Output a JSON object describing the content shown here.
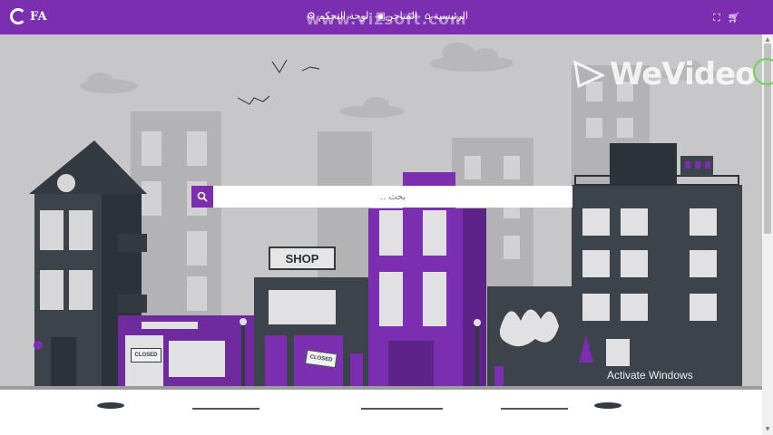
{
  "header": {
    "logo_text": "FA",
    "nav_items": [
      {
        "label": "الرئيسية",
        "icon": "home-icon"
      },
      {
        "label": "المتاجر",
        "icon": "store-icon"
      },
      {
        "label": "لوحة التحكم",
        "icon": "dashboard-icon"
      }
    ],
    "overlay_watermark": "www.vizsoft.com",
    "right_icons": [
      "scan-icon",
      "cart-icon"
    ]
  },
  "hero": {
    "search_placeholder": "بحث ..",
    "search_icon": "search-icon",
    "shop_sign": "SHOP",
    "closed_sign_1": "CLOSED",
    "closed_sign_2": "CLOSED"
  },
  "overlays": {
    "wevideo_watermark": "WeVideo",
    "activate_windows": "Activate Windows"
  },
  "colors": {
    "brand_purple": "#7b2fb0",
    "dark_building": "#333a42",
    "background_gray": "#c7c7c9"
  }
}
